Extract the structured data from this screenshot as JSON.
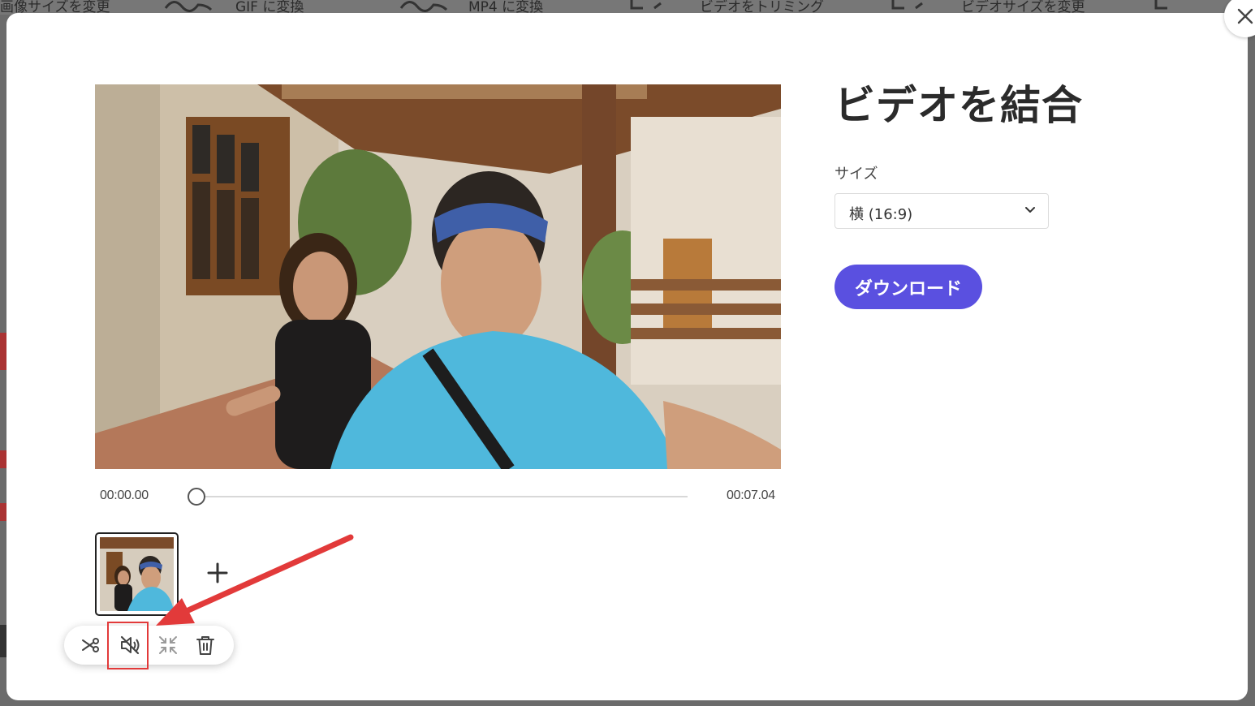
{
  "background_toolbar": {
    "items": [
      {
        "label": "画像サイズを変更"
      },
      {
        "label": "GIF に変換"
      },
      {
        "label": "MP4 に変換"
      },
      {
        "label": "ビデオをトリミング"
      },
      {
        "label": "ビデオサイズを変更"
      }
    ]
  },
  "modal": {
    "close_icon": "close-icon",
    "title": "ビデオを結合",
    "size": {
      "label": "サイズ",
      "selected": "横 (16:9)"
    },
    "download_label": "ダウンロード",
    "player": {
      "current_time": "00:00.00",
      "duration": "00:07.04",
      "progress": 0
    },
    "clip_toolbar": {
      "icons": [
        "scissors-icon",
        "mute-icon",
        "fit-icon",
        "trash-icon"
      ]
    }
  },
  "colors": {
    "accent": "#5a50e0",
    "highlight": "#e23a3a"
  }
}
